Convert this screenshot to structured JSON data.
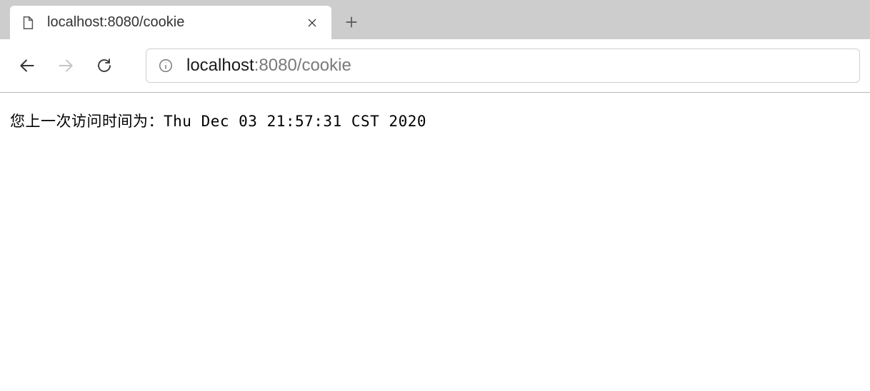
{
  "tab": {
    "title": "localhost:8080/cookie"
  },
  "address": {
    "host": "localhost",
    "path": ":8080/cookie"
  },
  "page": {
    "prefix": "您上一次访问时间为：",
    "timestamp": "Thu Dec 03 21:57:31 CST 2020"
  }
}
